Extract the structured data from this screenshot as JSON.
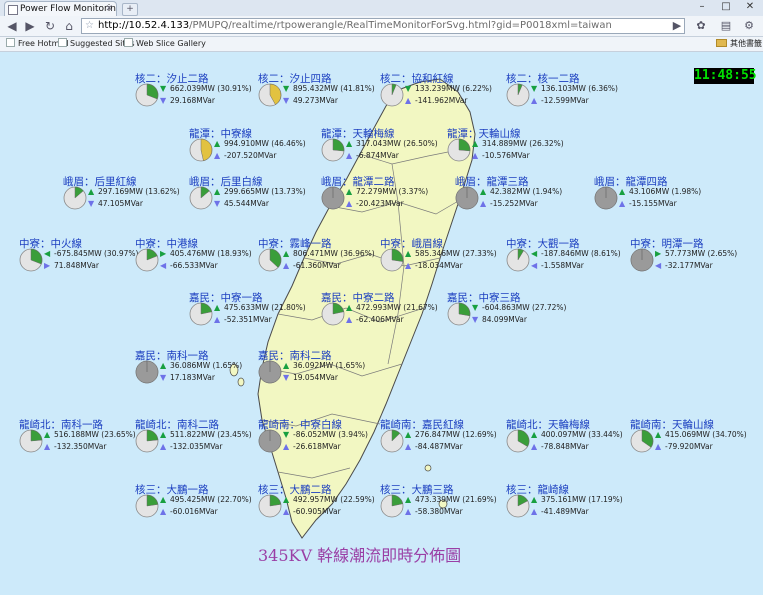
{
  "browser": {
    "tab_title": "Power Flow Monitoring",
    "url_host": "http://10.52.4.133",
    "url_path": "/PMUPQ/realtime/rtpowerangle/RealTimeMonitorForSvg.html?gid=P0018xml=taiwan",
    "bookmarks": [
      "Free Hotmail",
      "Suggested Sites",
      "Web Slice Gallery"
    ],
    "other_bookmarks": "其他書籤"
  },
  "clock": "11:48:55",
  "title": "345KV 幹線潮流即時分佈圖",
  "colors": {
    "map_land": "#f2f7c2",
    "map_sea": "#cdeafa",
    "pie_base": "#e4e4e4",
    "pie_green": "#3a9e3a",
    "pie_yellow": "#e2c240",
    "pie_dark": "#9a9a9a",
    "label_blue": "#1c3fc0",
    "title_purple": "#9a3fa5"
  },
  "lines": [
    {
      "name": "核二：汐止二路",
      "mw": "662.039MW (30.91%)",
      "mvar": "29.168MVar",
      "mw_dir": "down",
      "mvar_dir": "down",
      "pct": 30.91,
      "pie": "green"
    },
    {
      "name": "核二：汐止四路",
      "mw": "895.432MW (41.81%)",
      "mvar": "49.273MVar",
      "mw_dir": "down",
      "mvar_dir": "down",
      "pct": 41.81,
      "pie": "yellow"
    },
    {
      "name": "核二：協和紅線",
      "mw": "133.239MW (6.22%)",
      "mvar": "-141.962MVar",
      "mw_dir": "down",
      "mvar_dir": "up",
      "pct": 6.22,
      "pie": "green"
    },
    {
      "name": "核二：核一二路",
      "mw": "136.103MW (6.36%)",
      "mvar": "-12.599MVar",
      "mw_dir": "down",
      "mvar_dir": "up",
      "pct": 6.36,
      "pie": "green"
    },
    {
      "name": "龍潭：中寮線",
      "mw": "994.910MW (46.46%)",
      "mvar": "-207.520MVar",
      "mw_dir": "up",
      "mvar_dir": "up",
      "pct": 46.46,
      "pie": "yellow"
    },
    {
      "name": "龍潭：天輪梅線",
      "mw": "317.043MW (26.50%)",
      "mvar": "-6.874MVar",
      "mw_dir": "up",
      "mvar_dir": "up",
      "pct": 26.5,
      "pie": "green"
    },
    {
      "name": "龍潭：天輪山線",
      "mw": "314.889MW (26.32%)",
      "mvar": "-10.576MVar",
      "mw_dir": "up",
      "mvar_dir": "up",
      "pct": 26.32,
      "pie": "green"
    },
    {
      "name": "峨眉：后里紅線",
      "mw": "297.169MW (13.62%)",
      "mvar": "47.105MVar",
      "mw_dir": "up",
      "mvar_dir": "down",
      "pct": 13.62,
      "pie": "green"
    },
    {
      "name": "峨眉：后里白線",
      "mw": "299.665MW (13.73%)",
      "mvar": "45.544MVar",
      "mw_dir": "up",
      "mvar_dir": "down",
      "pct": 13.73,
      "pie": "green"
    },
    {
      "name": "峨眉：龍潭二路",
      "mw": "72.279MW (3.37%)",
      "mvar": "-20.423MVar",
      "mw_dir": "up",
      "mvar_dir": "up",
      "pct": 3.37,
      "pie": "dark"
    },
    {
      "name": "峨眉：龍潭三路",
      "mw": "42.382MW (1.94%)",
      "mvar": "-15.252MVar",
      "mw_dir": "up",
      "mvar_dir": "up",
      "pct": 1.94,
      "pie": "dark"
    },
    {
      "name": "峨眉：龍潭四路",
      "mw": "43.106MW (1.98%)",
      "mvar": "-15.155MVar",
      "mw_dir": "up",
      "mvar_dir": "up",
      "pct": 1.98,
      "pie": "dark"
    },
    {
      "name": "中寮：中火線",
      "mw": "-675.845MW (30.97%)",
      "mvar": "71.848MVar",
      "mw_dir": "left",
      "mvar_dir": "right",
      "pct": 30.97,
      "pie": "green"
    },
    {
      "name": "中寮：中港線",
      "mw": "405.476MW (18.93%)",
      "mvar": "-66.533MVar",
      "mw_dir": "right",
      "mvar_dir": "left",
      "pct": 18.93,
      "pie": "green"
    },
    {
      "name": "中寮：霧峰一路",
      "mw": "806.471MW (36.96%)",
      "mvar": "-61.360MVar",
      "mw_dir": "up",
      "mvar_dir": "up",
      "pct": 36.96,
      "pie": "green"
    },
    {
      "name": "中寮：峨眉線",
      "mw": "585.346MW (27.33%)",
      "mvar": "-18.034MVar",
      "mw_dir": "up",
      "mvar_dir": "up",
      "pct": 27.33,
      "pie": "green"
    },
    {
      "name": "中寮：大觀一路",
      "mw": "-187.846MW (8.61%)",
      "mvar": "-1.558MVar",
      "mw_dir": "left",
      "mvar_dir": "left",
      "pct": 8.61,
      "pie": "green"
    },
    {
      "name": "中寮：明潭一路",
      "mw": "57.773MW (2.65%)",
      "mvar": "-32.177MVar",
      "mw_dir": "right",
      "mvar_dir": "left",
      "pct": 2.65,
      "pie": "dark"
    },
    {
      "name": "嘉民：中寮一路",
      "mw": "475.633MW (21.80%)",
      "mvar": "-52.351MVar",
      "mw_dir": "up",
      "mvar_dir": "up",
      "pct": 21.8,
      "pie": "green"
    },
    {
      "name": "嘉民：中寮二路",
      "mw": "472.993MW (21.67%)",
      "mvar": "-62.406MVar",
      "mw_dir": "up",
      "mvar_dir": "up",
      "pct": 21.67,
      "pie": "green"
    },
    {
      "name": "嘉民：中寮三路",
      "mw": "-604.863MW (27.72%)",
      "mvar": "84.099MVar",
      "mw_dir": "down",
      "mvar_dir": "down",
      "pct": 27.72,
      "pie": "green"
    },
    {
      "name": "嘉民：南科一路",
      "mw": "36.086MW (1.65%)",
      "mvar": "17.183MVar",
      "mw_dir": "up",
      "mvar_dir": "down",
      "pct": 1.65,
      "pie": "dark"
    },
    {
      "name": "嘉民：南科二路",
      "mw": "36.092MW (1.65%)",
      "mvar": "19.054MVar",
      "mw_dir": "up",
      "mvar_dir": "down",
      "pct": 1.65,
      "pie": "dark"
    },
    {
      "name": "龍崎北：南科一路",
      "mw": "516.188MW (23.65%)",
      "mvar": "-132.350MVar",
      "mw_dir": "up",
      "mvar_dir": "up",
      "pct": 23.65,
      "pie": "green"
    },
    {
      "name": "龍崎北：南科二路",
      "mw": "511.822MW (23.45%)",
      "mvar": "-132.035MVar",
      "mw_dir": "up",
      "mvar_dir": "up",
      "pct": 23.45,
      "pie": "green"
    },
    {
      "name": "龍崎南：中寮白線",
      "mw": "-86.052MW (3.94%)",
      "mvar": "-26.618MVar",
      "mw_dir": "down",
      "mvar_dir": "up",
      "pct": 3.94,
      "pie": "dark"
    },
    {
      "name": "龍崎南：嘉民紅線",
      "mw": "276.847MW (12.69%)",
      "mvar": "-84.487MVar",
      "mw_dir": "up",
      "mvar_dir": "up",
      "pct": 12.69,
      "pie": "green"
    },
    {
      "name": "龍崎北：天輪梅線",
      "mw": "400.097MW (33.44%)",
      "mvar": "-78.848MVar",
      "mw_dir": "up",
      "mvar_dir": "up",
      "pct": 33.44,
      "pie": "green"
    },
    {
      "name": "龍崎南：天輪山線",
      "mw": "415.069MW (34.70%)",
      "mvar": "-79.920MVar",
      "mw_dir": "up",
      "mvar_dir": "up",
      "pct": 34.7,
      "pie": "green"
    },
    {
      "name": "核三：大鵬一路",
      "mw": "495.425MW (22.70%)",
      "mvar": "-60.016MVar",
      "mw_dir": "up",
      "mvar_dir": "up",
      "pct": 22.7,
      "pie": "green"
    },
    {
      "name": "核三：大鵬二路",
      "mw": "492.957MW (22.59%)",
      "mvar": "-60.905MVar",
      "mw_dir": "up",
      "mvar_dir": "up",
      "pct": 22.59,
      "pie": "green"
    },
    {
      "name": "核三：大鵬三路",
      "mw": "473.339MW (21.69%)",
      "mvar": "-58.380MVar",
      "mw_dir": "up",
      "mvar_dir": "up",
      "pct": 21.69,
      "pie": "green"
    },
    {
      "name": "核三：龍崎線",
      "mw": "375.161MW (17.19%)",
      "mvar": "-41.489MVar",
      "mw_dir": "up",
      "mvar_dir": "up",
      "pct": 17.19,
      "pie": "green"
    }
  ]
}
